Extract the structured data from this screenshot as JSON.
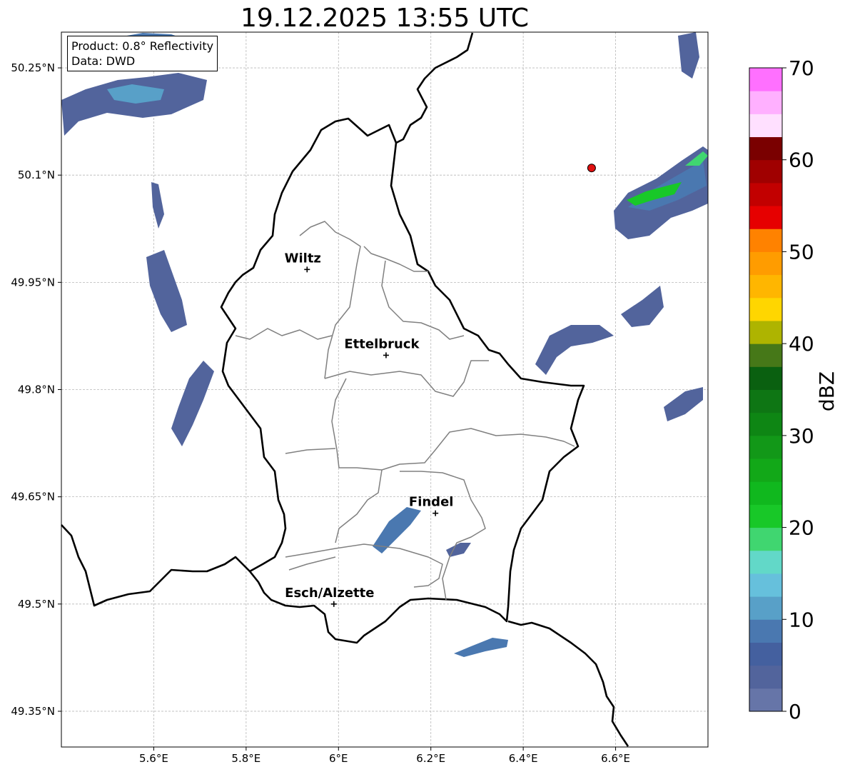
{
  "title": "19.12.2025 13:55 UTC",
  "info": {
    "product": "Product: 0.8° Reflectivity",
    "source": "Data: DWD"
  },
  "axes": {
    "lat_labels": [
      "50.25°N",
      "50.1°N",
      "49.95°N",
      "49.8°N",
      "49.65°N",
      "49.5°N",
      "49.35°N"
    ],
    "lon_labels": [
      "5.6°E",
      "5.8°E",
      "6°E",
      "6.2°E",
      "6.4°E",
      "6.6°E"
    ],
    "lat_values": [
      50.25,
      50.1,
      49.95,
      49.8,
      49.65,
      49.5,
      49.35
    ],
    "lon_values": [
      5.6,
      5.8,
      6.0,
      6.2,
      6.4,
      6.6
    ],
    "lat_range": [
      49.3,
      50.3
    ],
    "lon_range": [
      5.4,
      6.8
    ],
    "grid": true
  },
  "cities": [
    {
      "name": "Wiltz",
      "lat": 49.968,
      "lon": 5.932
    },
    {
      "name": "Ettelbruck",
      "lat": 49.848,
      "lon": 6.103
    },
    {
      "name": "Findel",
      "lat": 49.627,
      "lon": 6.21
    },
    {
      "name": "Esch/Alzette",
      "lat": 49.5,
      "lon": 5.99
    }
  ],
  "marker": {
    "lat": 50.11,
    "lon": 6.548,
    "color": "#e01010"
  },
  "colorbar": {
    "label": "dBZ",
    "ticks": [
      "0",
      "10",
      "20",
      "30",
      "40",
      "50",
      "60",
      "70"
    ],
    "range": [
      0,
      70
    ],
    "step": 2.5,
    "colors": [
      "#6675a8",
      "#52649c",
      "#44609f",
      "#4a78b0",
      "#58a0c8",
      "#66c0dc",
      "#62d8c8",
      "#40d670",
      "#18c828",
      "#10b81e",
      "#12a818",
      "#129818",
      "#0e8614",
      "#0e7614",
      "#0a6010",
      "#467818",
      "#aeb400",
      "#ffd600",
      "#ffb600",
      "#ff9c00",
      "#ff8200",
      "#e60000",
      "#c20000",
      "#a00000",
      "#7a0000",
      "#ffe0ff",
      "#ffb0ff",
      "#ff70ff",
      "#ec38ec"
    ]
  },
  "echo_colors": {
    "low": "#52649c",
    "mid": "#4a78b0",
    "light": "#58a0c8",
    "cyan": "#62d8c8",
    "green": "#18c828"
  }
}
